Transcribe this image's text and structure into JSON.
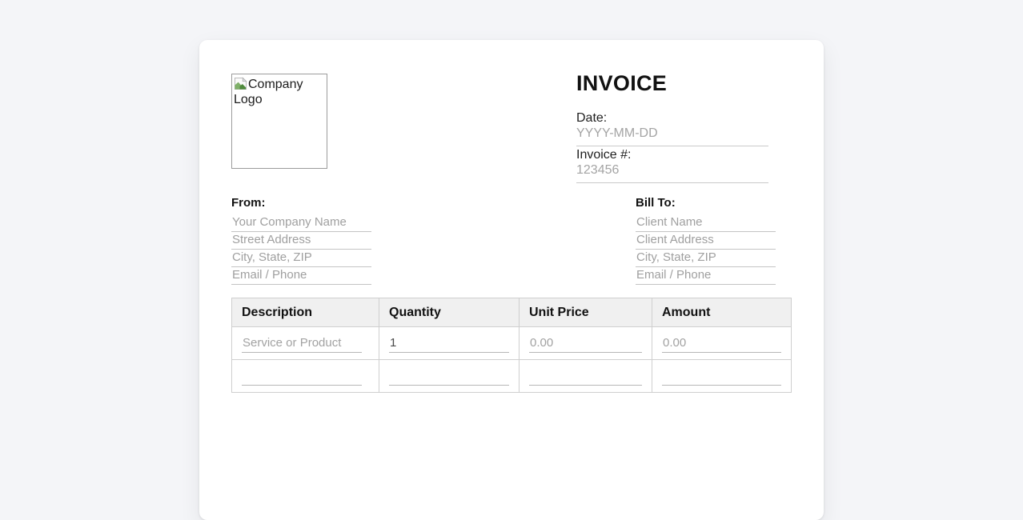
{
  "page": {
    "background_color": "#f4f5f8",
    "card_color": "#ffffff"
  },
  "invoice_header": {
    "title": "INVOICE",
    "logo_alt_text": "Company Logo",
    "date_label": "Date:",
    "date_placeholder": "YYYY-MM-DD",
    "number_label": "Invoice #:",
    "number_placeholder": "123456"
  },
  "from_section": {
    "label": "From:",
    "fields": [
      {
        "placeholder": "Your Company Name"
      },
      {
        "placeholder": "Street Address"
      },
      {
        "placeholder": "City, State, ZIP"
      },
      {
        "placeholder": "Email / Phone"
      }
    ]
  },
  "bill_to_section": {
    "label": "Bill To:",
    "fields": [
      {
        "placeholder": "Client Name"
      },
      {
        "placeholder": "Client Address"
      },
      {
        "placeholder": "City, State, ZIP"
      },
      {
        "placeholder": "Email / Phone"
      }
    ]
  },
  "items_table": {
    "headers": [
      "Description",
      "Quantity",
      "Unit Price",
      "Amount"
    ],
    "rows": [
      {
        "description_placeholder": "Service or Product",
        "quantity_value": "1",
        "unit_price_placeholder": "0.00",
        "amount_placeholder": "0.00"
      },
      {
        "description_placeholder": "",
        "quantity_value": "",
        "unit_price_placeholder": "",
        "amount_placeholder": ""
      }
    ]
  },
  "colors": {
    "table_header_bg": "#f0f0f0",
    "table_border": "#cfcfcf",
    "input_underline": "#c9c9c9",
    "placeholder_text": "#a4a4a4",
    "value_text": "#4a4a4a",
    "heading_text": "#111111"
  }
}
